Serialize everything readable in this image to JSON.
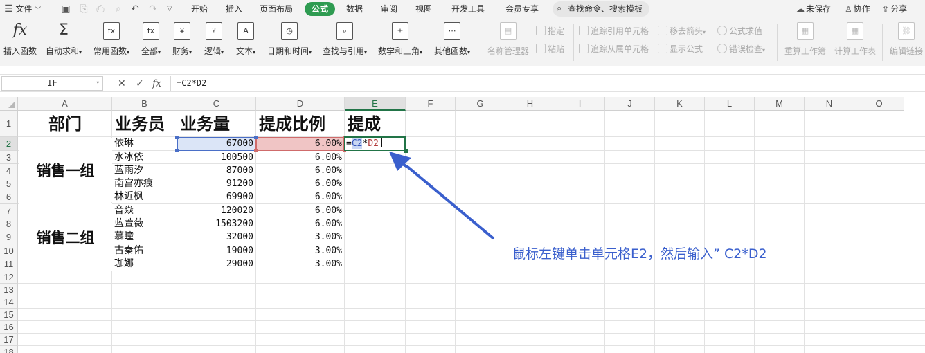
{
  "menubar": {
    "file_label": "文件",
    "tabs": [
      {
        "label": "开始",
        "active": false
      },
      {
        "label": "插入",
        "active": false
      },
      {
        "label": "页面布局",
        "active": false
      },
      {
        "label": "公式",
        "active": true
      },
      {
        "label": "数据",
        "active": false
      },
      {
        "label": "审阅",
        "active": false
      },
      {
        "label": "视图",
        "active": false
      },
      {
        "label": "开发工具",
        "active": false
      },
      {
        "label": "会员专享",
        "active": false
      }
    ],
    "search_placeholder": "查找命令、搜索模板",
    "unsaved_label": "未保存",
    "collab_label": "协作",
    "share_label": "分享"
  },
  "ribbon": {
    "insert_function": "插入函数",
    "autosum": "自动求和",
    "common_functions": "常用函数",
    "all": "全部",
    "finance": "财务",
    "logic": "逻辑",
    "text": "文本",
    "datetime": "日期和时间",
    "lookup": "查找与引用",
    "math": "数学和三角",
    "other": "其他函数",
    "name_manager": "名称管理器",
    "specify": "指定",
    "paste": "粘贴",
    "trace_precedents": "追踪引用单元格",
    "trace_dependents": "追踪从属单元格",
    "remove_arrows": "移去箭头",
    "show_formulas": "显示公式",
    "evaluate_formula": "公式求值",
    "error_check": "错误检查",
    "recalc_workbook": "重算工作簿",
    "calc_sheet": "计算工作表",
    "edit_links": "编辑链接"
  },
  "formula_bar": {
    "name_box": "IF",
    "formula": "=C2*D2",
    "cancel": "✕",
    "confirm": "✓",
    "fx": "fx"
  },
  "sheet": {
    "columns": [
      "A",
      "B",
      "C",
      "D",
      "E",
      "F",
      "G",
      "H",
      "I",
      "J",
      "K",
      "L",
      "M",
      "N",
      "O"
    ],
    "rows": [
      "1",
      "2",
      "3",
      "4",
      "5",
      "6",
      "7",
      "8",
      "9",
      "10",
      "11",
      "12",
      "13",
      "14",
      "15",
      "16",
      "17",
      "18"
    ],
    "header": {
      "dept": "部门",
      "salesperson": "业务员",
      "volume": "业务量",
      "ratio": "提成比例",
      "commission": "提成"
    },
    "groups": [
      {
        "name": "销售一组"
      },
      {
        "name": "销售二组"
      }
    ],
    "records": [
      {
        "name": "依琳",
        "volume": "67000",
        "ratio": "6.00%"
      },
      {
        "name": "水冰依",
        "volume": "100500",
        "ratio": "6.00%"
      },
      {
        "name": "蓝雨汐",
        "volume": "87000",
        "ratio": "6.00%"
      },
      {
        "name": "南宫亦痕",
        "volume": "91200",
        "ratio": "6.00%"
      },
      {
        "name": "林近枫",
        "volume": "69900",
        "ratio": "6.00%"
      },
      {
        "name": "音焱",
        "volume": "120020",
        "ratio": "6.00%"
      },
      {
        "name": "蓝萱薇",
        "volume": "1503200",
        "ratio": "6.00%"
      },
      {
        "name": "慕瞳",
        "volume": "32000",
        "ratio": "3.00%"
      },
      {
        "name": "古秦佑",
        "volume": "19000",
        "ratio": "3.00%"
      },
      {
        "name": "珈娜",
        "volume": "29000",
        "ratio": "3.00%"
      }
    ],
    "editing": {
      "eq": "=",
      "ref1": "C2",
      "op": "*",
      "ref2": "D2"
    }
  },
  "annotation": "鼠标左键单击单元格E2，然后输入” C2*D2",
  "colors": {
    "accent": "#2e9b51",
    "annotation": "#3a5fcd",
    "ref_c2": "#4a6fc7",
    "ref_d2": "#cf6b6b"
  }
}
